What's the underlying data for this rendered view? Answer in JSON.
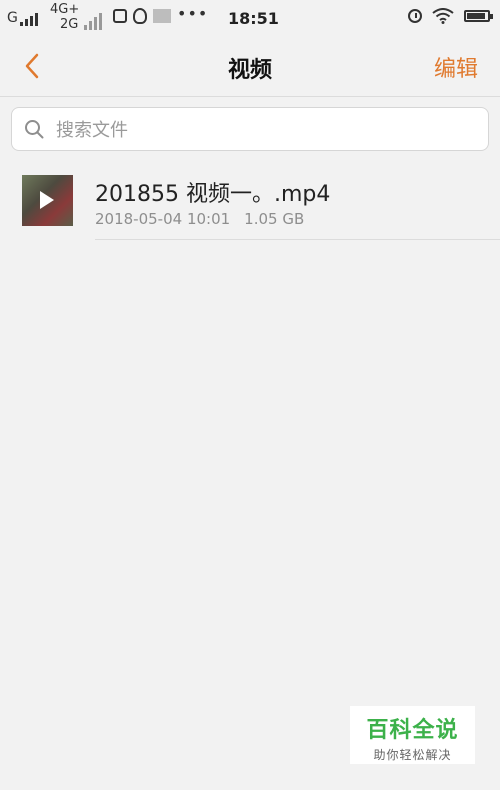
{
  "status_bar": {
    "carrier": "G",
    "network_top": "4G+",
    "network_bottom": "2G",
    "dots": "•••",
    "time": "18:51"
  },
  "header": {
    "title": "视频",
    "edit_label": "编辑"
  },
  "search": {
    "placeholder": "搜索文件",
    "value": ""
  },
  "files": [
    {
      "name": "201855 视频一。.mp4",
      "date": "2018-05-04 10:01",
      "size": "1.05 GB"
    }
  ],
  "watermark": {
    "title": "百科全说",
    "subtitle": "助你轻松解决"
  },
  "colors": {
    "accent": "#e07a2f",
    "background": "#f2f2f2",
    "watermark_green": "#3cb14a"
  },
  "icons": {
    "back": "chevron-left-icon",
    "search": "search-icon",
    "play": "play-icon",
    "alarm": "alarm-icon",
    "wifi": "wifi-icon",
    "battery": "battery-icon"
  }
}
